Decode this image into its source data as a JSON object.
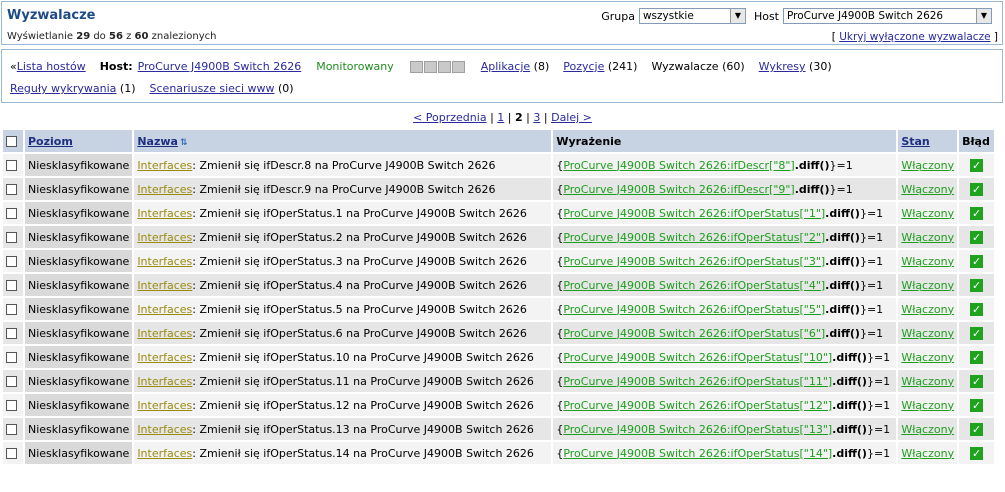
{
  "header": {
    "title": "Wyzwalacze",
    "count": {
      "prefix": "Wyświetlanie ",
      "from": "29",
      "mid1": " do ",
      "to": "56",
      "mid2": " z ",
      "total": "60",
      "suffix": " znalezionych"
    },
    "group_label": "Grupa",
    "group_value": "wszystkie",
    "host_label": "Host",
    "host_value": "ProCurve J4900B Switch 2626",
    "hide_link_open": "[ ",
    "hide_link": "Ukryj wyłączone wyzwalacze",
    "hide_link_close": " ]"
  },
  "nav": {
    "back_prefix": "« ",
    "back": "Lista hostów",
    "host_label": "Host:",
    "host_name": "ProCurve J4900B Switch 2626",
    "status": "Monitorowany",
    "apps": "Aplikacje",
    "apps_count": "(8)",
    "items": "Pozycje",
    "items_count": "(241)",
    "triggers": "Wyzwalacze",
    "triggers_count": "(60)",
    "graphs": "Wykresy",
    "graphs_count": "(30)",
    "discovery": "Reguły wykrywania",
    "discovery_count": "(1)",
    "web": "Scenariusze sieci www",
    "web_count": "(0)"
  },
  "paging": {
    "prev": "< Poprzednia",
    "p1": "1",
    "p2": "2",
    "p3": "3",
    "next": "Dalej >",
    "sep": "|"
  },
  "table": {
    "columns": {
      "level": "Poziom",
      "name": "Nazwa",
      "expr": "Wyrażenie",
      "status": "Stan",
      "error": "Błąd"
    },
    "rows": [
      {
        "level": "Niesklasyfikowane",
        "app": "Interfaces",
        "name": ": Zmienił się ifDescr.8 na ProCurve J4900B Switch 2626",
        "expr_open": "{",
        "expr_link": "ProCurve J4900B Switch 2626:ifDescr[\"8\"]",
        "expr_fn": ".diff()",
        "expr_close": "}=1",
        "status": "Włączony"
      },
      {
        "level": "Niesklasyfikowane",
        "app": "Interfaces",
        "name": ": Zmienił się ifDescr.9 na ProCurve J4900B Switch 2626",
        "expr_open": "{",
        "expr_link": "ProCurve J4900B Switch 2626:ifDescr[\"9\"]",
        "expr_fn": ".diff()",
        "expr_close": "}=1",
        "status": "Włączony"
      },
      {
        "level": "Niesklasyfikowane",
        "app": "Interfaces",
        "name": ": Zmienił się ifOperStatus.1 na ProCurve J4900B Switch 2626",
        "expr_open": "{",
        "expr_link": "ProCurve J4900B Switch 2626:ifOperStatus[\"1\"]",
        "expr_fn": ".diff()",
        "expr_close": "}=1",
        "status": "Włączony"
      },
      {
        "level": "Niesklasyfikowane",
        "app": "Interfaces",
        "name": ": Zmienił się ifOperStatus.2 na ProCurve J4900B Switch 2626",
        "expr_open": "{",
        "expr_link": "ProCurve J4900B Switch 2626:ifOperStatus[\"2\"]",
        "expr_fn": ".diff()",
        "expr_close": "}=1",
        "status": "Włączony"
      },
      {
        "level": "Niesklasyfikowane",
        "app": "Interfaces",
        "name": ": Zmienił się ifOperStatus.3 na ProCurve J4900B Switch 2626",
        "expr_open": "{",
        "expr_link": "ProCurve J4900B Switch 2626:ifOperStatus[\"3\"]",
        "expr_fn": ".diff()",
        "expr_close": "}=1",
        "status": "Włączony"
      },
      {
        "level": "Niesklasyfikowane",
        "app": "Interfaces",
        "name": ": Zmienił się ifOperStatus.4 na ProCurve J4900B Switch 2626",
        "expr_open": "{",
        "expr_link": "ProCurve J4900B Switch 2626:ifOperStatus[\"4\"]",
        "expr_fn": ".diff()",
        "expr_close": "}=1",
        "status": "Włączony"
      },
      {
        "level": "Niesklasyfikowane",
        "app": "Interfaces",
        "name": ": Zmienił się ifOperStatus.5 na ProCurve J4900B Switch 2626",
        "expr_open": "{",
        "expr_link": "ProCurve J4900B Switch 2626:ifOperStatus[\"5\"]",
        "expr_fn": ".diff()",
        "expr_close": "}=1",
        "status": "Włączony"
      },
      {
        "level": "Niesklasyfikowane",
        "app": "Interfaces",
        "name": ": Zmienił się ifOperStatus.6 na ProCurve J4900B Switch 2626",
        "expr_open": "{",
        "expr_link": "ProCurve J4900B Switch 2626:ifOperStatus[\"6\"]",
        "expr_fn": ".diff()",
        "expr_close": "}=1",
        "status": "Włączony"
      },
      {
        "level": "Niesklasyfikowane",
        "app": "Interfaces",
        "name": ": Zmienił się ifOperStatus.10 na ProCurve J4900B Switch 2626",
        "expr_open": "{",
        "expr_link": "ProCurve J4900B Switch 2626:ifOperStatus[\"10\"]",
        "expr_fn": ".diff()",
        "expr_close": "}=1",
        "status": "Włączony"
      },
      {
        "level": "Niesklasyfikowane",
        "app": "Interfaces",
        "name": ": Zmienił się ifOperStatus.11 na ProCurve J4900B Switch 2626",
        "expr_open": "{",
        "expr_link": "ProCurve J4900B Switch 2626:ifOperStatus[\"11\"]",
        "expr_fn": ".diff()",
        "expr_close": "}=1",
        "status": "Włączony"
      },
      {
        "level": "Niesklasyfikowane",
        "app": "Interfaces",
        "name": ": Zmienił się ifOperStatus.12 na ProCurve J4900B Switch 2626",
        "expr_open": "{",
        "expr_link": "ProCurve J4900B Switch 2626:ifOperStatus[\"12\"]",
        "expr_fn": ".diff()",
        "expr_close": "}=1",
        "status": "Włączony"
      },
      {
        "level": "Niesklasyfikowane",
        "app": "Interfaces",
        "name": ": Zmienił się ifOperStatus.13 na ProCurve J4900B Switch 2626",
        "expr_open": "{",
        "expr_link": "ProCurve J4900B Switch 2626:ifOperStatus[\"13\"]",
        "expr_fn": ".diff()",
        "expr_close": "}=1",
        "status": "Włączony"
      },
      {
        "level": "Niesklasyfikowane",
        "app": "Interfaces",
        "name": ": Zmienił się ifOperStatus.14 na ProCurve J4900B Switch 2626",
        "expr_open": "{",
        "expr_link": "ProCurve J4900B Switch 2626:ifOperStatus[\"14\"]",
        "expr_fn": ".diff()",
        "expr_close": "}=1",
        "status": "Włączony"
      }
    ]
  },
  "colors": {
    "header_bg": "#c7d3e3",
    "link_green": "#1e9e1e",
    "title_blue": "#1e4a86",
    "app_olive": "#9a8a10",
    "check_green": "#1fa31f"
  },
  "icons": {
    "error_ok": "check-icon",
    "sort": "sort-asc-icon",
    "dropdown": "chevron-down-icon"
  }
}
